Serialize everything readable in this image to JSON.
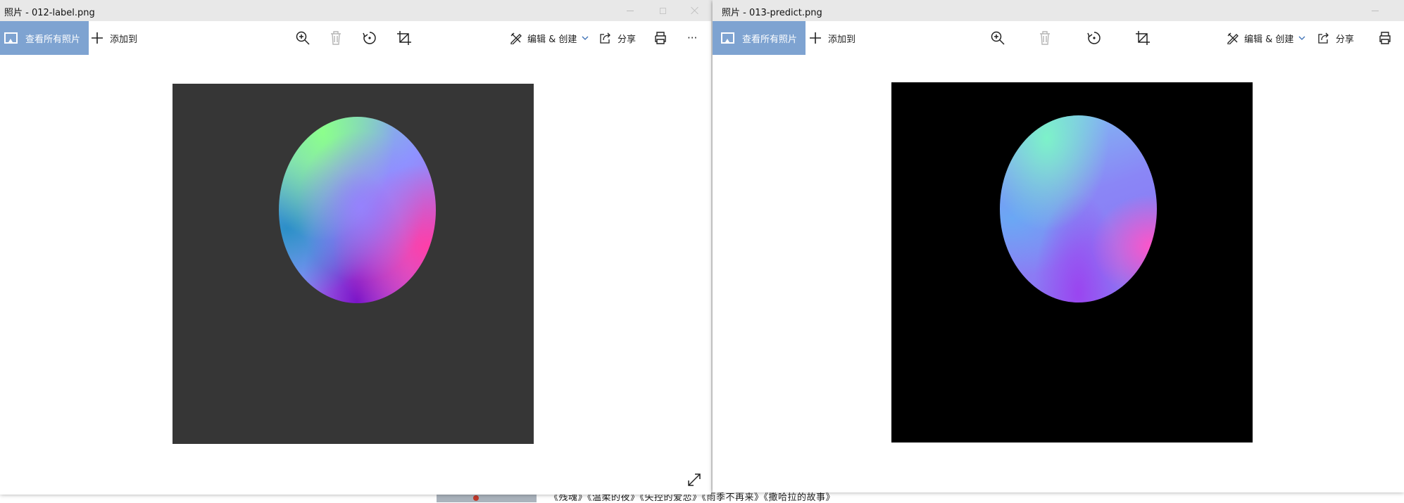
{
  "background": {
    "caption": "《残魂》《温柔的夜》《失控的爱恋》《雨季不再来》《撒哈拉的故事》"
  },
  "left_window": {
    "title": "照片 - 012-label.png",
    "toolbar": {
      "view_all_label": "查看所有照片",
      "add_to_label": "添加到",
      "edit_create_label": "编辑 & 创建",
      "share_label": "分享",
      "more_label": "···"
    },
    "image": {
      "background_color": "#363636",
      "content": "normal-map-sphere"
    }
  },
  "right_window": {
    "title": "照片 - 013-predict.png",
    "toolbar": {
      "view_all_label": "查看所有照片",
      "add_to_label": "添加到",
      "edit_create_label": "编辑 & 创建",
      "share_label": "分享"
    },
    "image": {
      "background_color": "#000000",
      "content": "normal-map-sphere"
    }
  },
  "colors": {
    "accent": "#7ea3d1",
    "titlebar": "#e8e8e8"
  }
}
